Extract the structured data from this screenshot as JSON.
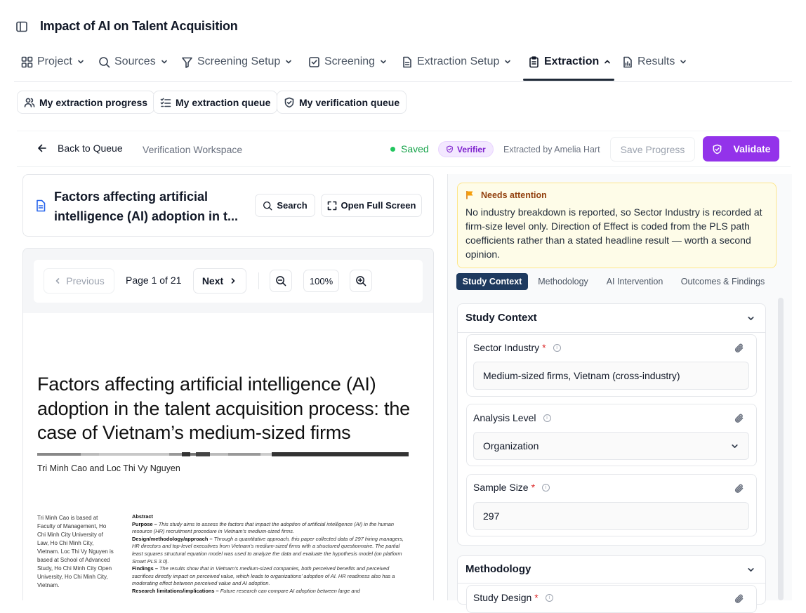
{
  "app": {
    "title": "Impact of AI on Talent Acquisition"
  },
  "nav": [
    {
      "label": "Project",
      "icon": "grid-icon"
    },
    {
      "label": "Sources",
      "icon": "search-icon"
    },
    {
      "label": "Screening Setup",
      "icon": "filter-icon"
    },
    {
      "label": "Screening",
      "icon": "checkbox-icon"
    },
    {
      "label": "Extraction Setup",
      "icon": "file-icon"
    },
    {
      "label": "Extraction",
      "icon": "clipboard-icon",
      "active": true
    },
    {
      "label": "Results",
      "icon": "report-icon"
    }
  ],
  "queues": {
    "progress": "My extraction progress",
    "extraction": "My extraction queue",
    "verification": "My verification queue"
  },
  "toolbar": {
    "back": "Back to Queue",
    "workspace": "Verification Workspace",
    "saved": "Saved",
    "verifier": "Verifier",
    "extracted_by": "Extracted by Amelia Hart",
    "save_progress": "Save Progress",
    "validate": "Validate"
  },
  "document": {
    "title": "Factors affecting artificial intelligence (AI) adoption in t...",
    "search": "Search",
    "fullscreen": "Open Full Screen",
    "previous": "Previous",
    "page_info": "Page 1 of 21",
    "next": "Next",
    "zoom": "100%"
  },
  "pdf": {
    "title": "Factors affecting artificial intelligence (AI) adoption in the talent acquisition process: the case of Vietnam’s medium-sized firms",
    "authors": "Tri Minh Cao and Loc Thi Vy Nguyen",
    "affiliation": "Tri Minh Cao is based at Faculty of Management, Ho Chi Minh City University of Law, Ho Chi Minh City, Vietnam. Loc Thi Vy Nguyen is based at School of Advanced Study, Ho Chi Minh City Open University, Ho Chi Minh City, Vietnam.",
    "abstract_heading": "Abstract",
    "purpose_label": "Purpose –",
    "purpose": "This study aims to assess the factors that impact the adoption of artificial intelligence (AI) in the human resource (HR) recruitment procedure in Vietnam’s medium-sized firms.",
    "design_label": "Design/methodology/approach –",
    "design": "Through a quantitative approach, this paper collected data of 297 hiring managers, HR directors and top-level executives from Vietnam’s medium-sized firms with a structured questionnaire. The partial least squares structural equation model was used to analyze the data and evaluate the hypothesis model (on platform Smart PLS 3.0).",
    "findings_label": "Findings –",
    "findings": "The results show that in Vietnam’s medium-sized companies, both perceived benefits and perceived sacrifices directly impact on perceived value, which leads to organizations’ adoption of AI. HR readiness also has a moderating effect between perceived value and AI adoption.",
    "limits_label": "Research limitations/implications –",
    "limits": "Future research can compare AI adoption between large and"
  },
  "alert": {
    "title": "Needs attention",
    "body": "No industry breakdown is reported, so Sector Industry is recorded at firm-size level only. Direction of Effect is coded from the PLS path coefficients rather than a stated headline result — worth a second opinion."
  },
  "tabs": [
    "Study Context",
    "Methodology",
    "AI Intervention",
    "Outcomes & Findings"
  ],
  "sections": {
    "study_context": {
      "title": "Study Context",
      "sector_label": "Sector Industry",
      "sector_value": "Medium-sized firms, Vietnam (cross-industry)",
      "analysis_label": "Analysis Level",
      "analysis_value": "Organization",
      "sample_label": "Sample Size",
      "sample_value": "297"
    },
    "methodology": {
      "title": "Methodology",
      "design_label": "Study Design"
    }
  },
  "colors": {
    "accent": "#9333ea",
    "tab_active": "#1e3a5f",
    "saved": "#16a34a",
    "alert_bg": "#fefce8"
  }
}
